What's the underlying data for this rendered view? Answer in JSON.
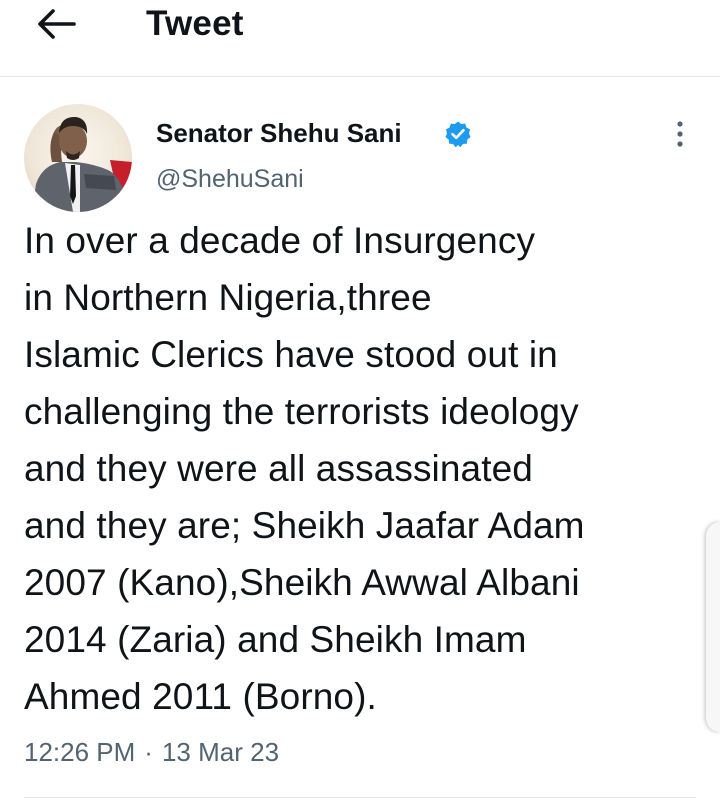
{
  "header": {
    "title": "Tweet",
    "back_icon": "arrow-left-icon"
  },
  "tweet": {
    "author": {
      "display_name": "Senator Shehu Sani",
      "handle": "@ShehuSani",
      "verified": true,
      "verified_icon": "verified-badge-icon",
      "verified_color": "#1d9bf0"
    },
    "more_icon": "more-vertical-icon",
    "text_lines": [
      "In over a decade of Insurgency",
      "in Northern Nigeria,three",
      "Islamic Clerics have stood out in",
      "challenging the terrorists ideology",
      "and they were all assassinated",
      "and they are; Sheikh Jaafar Adam",
      "2007 (Kano),Sheikh Awwal Albani",
      "2014 (Zaria) and Sheikh Imam",
      "Ahmed 2011 (Borno)."
    ],
    "time": "12:26 PM",
    "separator": "·",
    "date": "13 Mar 23"
  },
  "colors": {
    "text": "#0f1419",
    "secondary": "#536471",
    "divider": "#e3e6e8",
    "accent": "#1d9bf0"
  }
}
